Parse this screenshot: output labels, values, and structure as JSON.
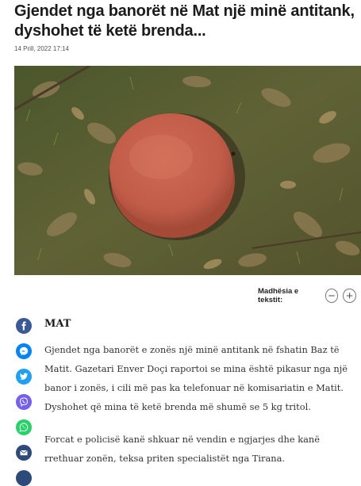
{
  "article": {
    "title": "Gjendet nga banorët në Mat një minë antitank, dyshohet të ketë brenda...",
    "date": "14 Prill, 2022 17:14",
    "section": "MAT",
    "paragraphs": [
      "Gjendet nga banorët e zonës një minë antitank në fshatin Baz të Matit. Gazetari Enver Doçi raportoi se mina është pikasur nga një banor i zonës, i cili më pas ka telefonuar në komisariatin e Matit. Dyshohet që mina të ketë brenda më shumë se 5 kg tritol.",
      "Forcat e policisë kanë shkuar në vendin e ngjarjes dhe kanë rrethuar zonën, teksa priten specialistët nga Tirana."
    ]
  },
  "font_size_control": {
    "label": "Madhësia e tekstit:",
    "decrease": "−",
    "increase": "+"
  },
  "share": [
    {
      "network": "facebook",
      "icon": "facebook-icon",
      "color": "#3b5998"
    },
    {
      "network": "messenger",
      "icon": "messenger-icon",
      "color": "#0084ff"
    },
    {
      "network": "twitter",
      "icon": "twitter-icon",
      "color": "#1da1f2"
    },
    {
      "network": "viber",
      "icon": "viber-icon",
      "color": "#7360f2"
    },
    {
      "network": "whatsapp",
      "icon": "whatsapp-icon",
      "color": "#25d366"
    },
    {
      "network": "email",
      "icon": "email-icon",
      "color": "#2c4a7a"
    }
  ]
}
